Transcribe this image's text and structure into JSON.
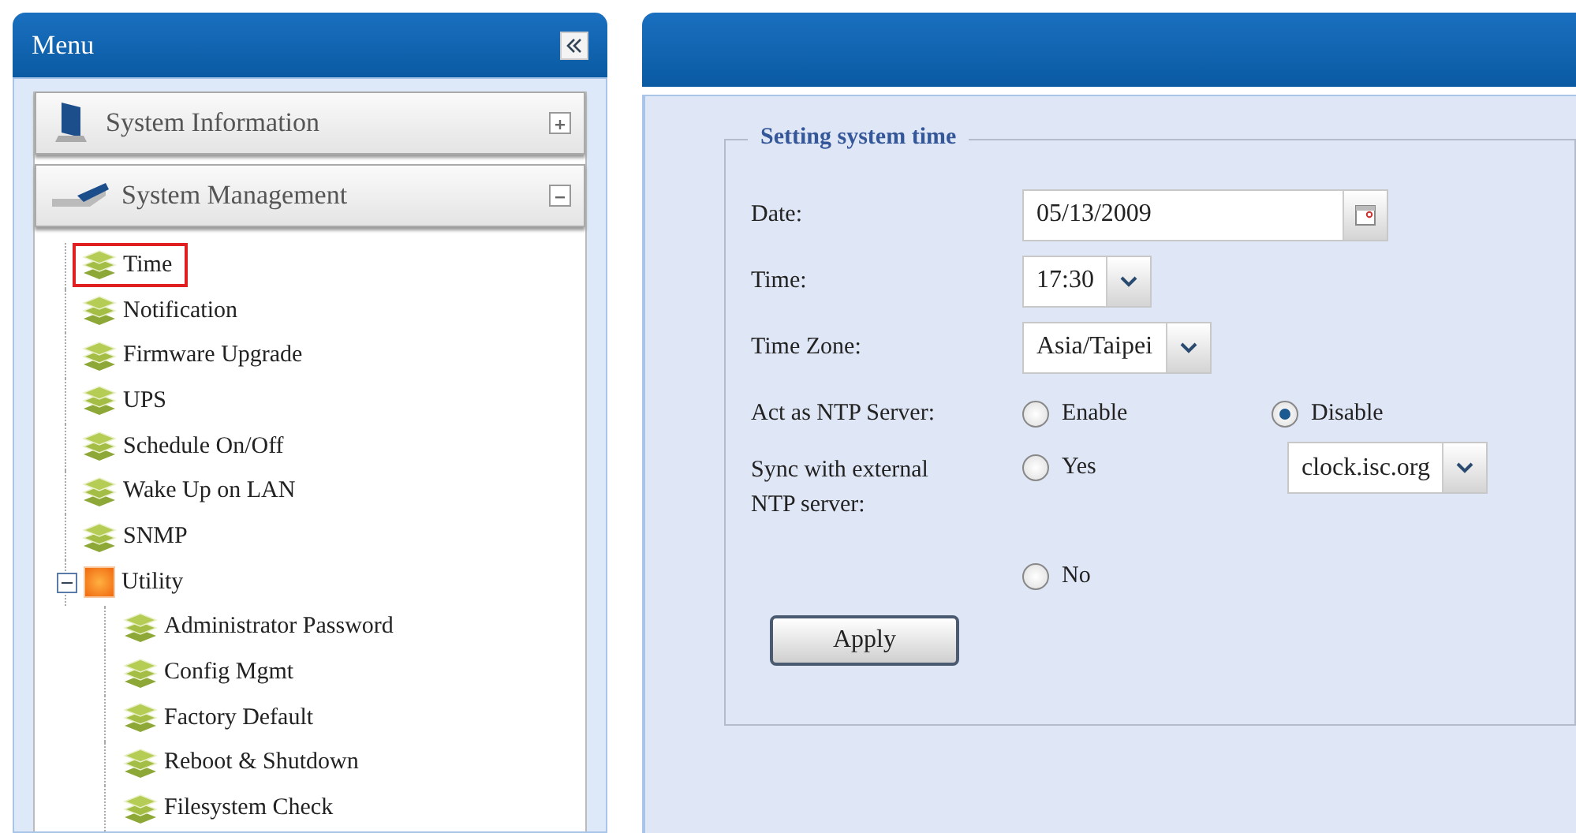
{
  "menu": {
    "title": "Menu",
    "sections": [
      {
        "label": "System Information",
        "kind": "monitor",
        "expanded": false
      },
      {
        "label": "System Management",
        "kind": "drive",
        "expanded": true,
        "items": [
          {
            "label": "Time",
            "kind": "page",
            "selected": true
          },
          {
            "label": "Notification",
            "kind": "page",
            "selected": false
          },
          {
            "label": "Firmware Upgrade",
            "kind": "page",
            "selected": false
          },
          {
            "label": "UPS",
            "kind": "page",
            "selected": false
          },
          {
            "label": "Schedule On/Off",
            "kind": "page",
            "selected": false
          },
          {
            "label": "Wake Up on LAN",
            "kind": "page",
            "selected": false
          },
          {
            "label": "SNMP",
            "kind": "page",
            "selected": false
          },
          {
            "label": "Utility",
            "kind": "folder",
            "selected": false,
            "expanded": true,
            "children": [
              {
                "label": "Administrator Password",
                "kind": "page",
                "selected": false
              },
              {
                "label": "Config Mgmt",
                "kind": "page",
                "selected": false
              },
              {
                "label": "Factory Default",
                "kind": "page",
                "selected": false
              },
              {
                "label": "Reboot & Shutdown",
                "kind": "page",
                "selected": false
              },
              {
                "label": "Filesystem Check",
                "kind": "page",
                "selected": false
              }
            ]
          }
        ]
      }
    ]
  },
  "form": {
    "legend": "Setting system time",
    "date": {
      "label": "Date:",
      "value": "05/13/2009"
    },
    "time": {
      "label": "Time:",
      "value": "17:30"
    },
    "time_zone": {
      "label": "Time Zone:",
      "value": "Asia/Taipei"
    },
    "ntp_server": {
      "label": "Act as NTP Server:",
      "options": [
        {
          "label": "Enable",
          "selected": false
        },
        {
          "label": "Disable",
          "selected": true
        }
      ]
    },
    "sync": {
      "label": "Sync with external NTP server:",
      "options": [
        {
          "label": "Yes",
          "selected": false
        },
        {
          "label": "No",
          "selected": false
        }
      ],
      "server": "clock.isc.org"
    },
    "apply": "Apply"
  }
}
